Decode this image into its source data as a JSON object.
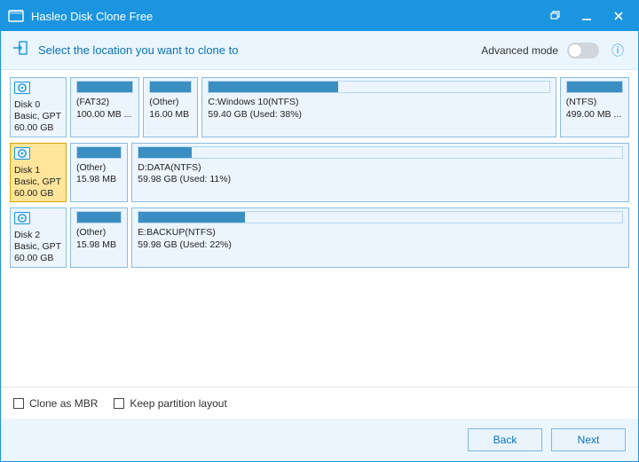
{
  "title": "Hasleo Disk Clone Free",
  "instruction": "Select the location you want to clone to",
  "advanced_label": "Advanced mode",
  "clone_mbr_label": "Clone as MBR",
  "keep_layout_label": "Keep partition layout",
  "back_label": "Back",
  "next_label": "Next",
  "disks": [
    {
      "name": "Disk 0",
      "type": "Basic, GPT",
      "size": "60.00 GB",
      "selected": false,
      "parts": [
        {
          "label": "(FAT32)",
          "size": "100.00 MB ...",
          "fill": 100,
          "flex": 8
        },
        {
          "label": "(Other)",
          "size": "16.00 MB",
          "fill": 100,
          "flex": 6
        },
        {
          "label": "C:Windows 10(NTFS)",
          "size": "59.40 GB (Used: 38%)",
          "fill": 38,
          "flex": 48
        },
        {
          "label": "(NTFS)",
          "size": "499.00 MB ...",
          "fill": 100,
          "flex": 8
        }
      ]
    },
    {
      "name": "Disk 1",
      "type": "Basic, GPT",
      "size": "60.00 GB",
      "selected": true,
      "parts": [
        {
          "label": "(Other)",
          "size": "15.98 MB",
          "fill": 100,
          "flex": 6
        },
        {
          "label": "D:DATA(NTFS)",
          "size": "59.98 GB (Used: 11%)",
          "fill": 11,
          "flex": 64
        }
      ]
    },
    {
      "name": "Disk 2",
      "type": "Basic, GPT",
      "size": "60.00 GB",
      "selected": false,
      "parts": [
        {
          "label": "(Other)",
          "size": "15.98 MB",
          "fill": 100,
          "flex": 6
        },
        {
          "label": "E:BACKUP(NTFS)",
          "size": "59.98 GB (Used: 22%)",
          "fill": 22,
          "flex": 64
        }
      ]
    }
  ]
}
